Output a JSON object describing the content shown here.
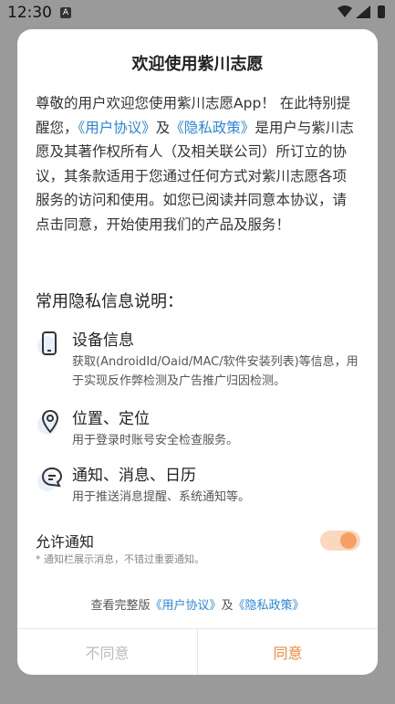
{
  "status_bar": {
    "time": "12:30",
    "notification_icon": "A"
  },
  "dialog": {
    "title": "欢迎使用紫川志愿",
    "intro": {
      "part1": "尊敬的用户欢迎您使用紫川志愿App！ 在此特别提醒您，",
      "link_user_agreement": "《用户协议》",
      "and1": "及",
      "link_privacy": "《隐私政策》",
      "part2": "是用户与紫川志愿及其著作权所有人（及相关联公司）所订立的协议，其条款适用于您通过任何方式对紫川志愿各项服务的访问和使用。如您已阅读并同意本协议，请点击同意，开始使用我们的产品及服务！"
    },
    "section_title": "常用隐私信息说明：",
    "items": [
      {
        "icon": "phone-icon",
        "label": "设备信息",
        "desc": "获取(AndroidId/Oaid/MAC/软件安装列表)等信息，用于实现反作弊检测及广告推广归因检测。"
      },
      {
        "icon": "location-pin-icon",
        "label": "位置、定位",
        "desc": "用于登录时账号安全检查服务。"
      },
      {
        "icon": "message-icon",
        "label": "通知、消息、日历",
        "desc": "用于推送消息提醒、系统通知等。"
      }
    ],
    "allow_notifications": {
      "label": "允许通知",
      "note": "* 通知栏展示消息，不错过重要通知。",
      "enabled": true
    },
    "footer": {
      "prefix": "查看完整版",
      "link_user_agreement": "《用户协议》",
      "and": "及",
      "link_privacy": "《隐私政策》"
    },
    "buttons": {
      "disagree": "不同意",
      "agree": "同意"
    }
  },
  "colors": {
    "accent": "#f08a3a",
    "link": "#2b86d9",
    "toggle_bg": "#fbd7bf",
    "toggle_knob": "#f7a066"
  }
}
